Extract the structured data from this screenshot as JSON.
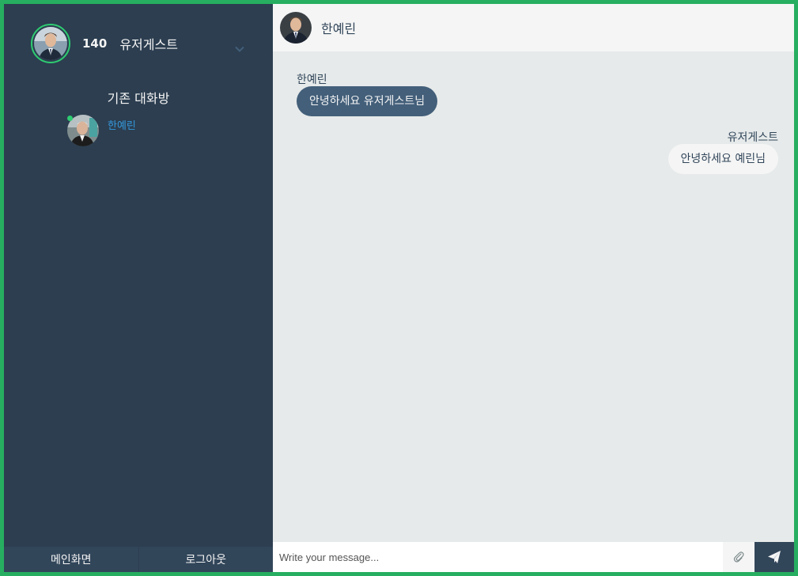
{
  "user": {
    "id": "140",
    "name": "유저게스트"
  },
  "sidebar": {
    "section_title": "기존 대화방",
    "contacts": [
      {
        "name": "한예린",
        "status": "online"
      }
    ],
    "bottom": {
      "home_label": "메인화면",
      "logout_label": "로그아웃"
    }
  },
  "chat": {
    "partner_name": "한예린",
    "messages": [
      {
        "sender": "한예린",
        "text": "안녕하세요 유저게스트님",
        "type": "received"
      },
      {
        "sender": "유저게스트",
        "text": "안녕하세요 예린님",
        "type": "sent"
      }
    ],
    "input": {
      "placeholder": "Write your message..."
    }
  },
  "icons": {
    "chevron": "chevron-down-icon",
    "attach": "paperclip-icon",
    "send": "paper-plane-icon"
  },
  "colors": {
    "sidebar_bg": "#2c3e50",
    "accent_green": "#2ecc71",
    "received_bubble": "#435f7a",
    "sent_bubble": "#f5f5f5",
    "link": "#3498db",
    "frame": "#27ae60"
  }
}
